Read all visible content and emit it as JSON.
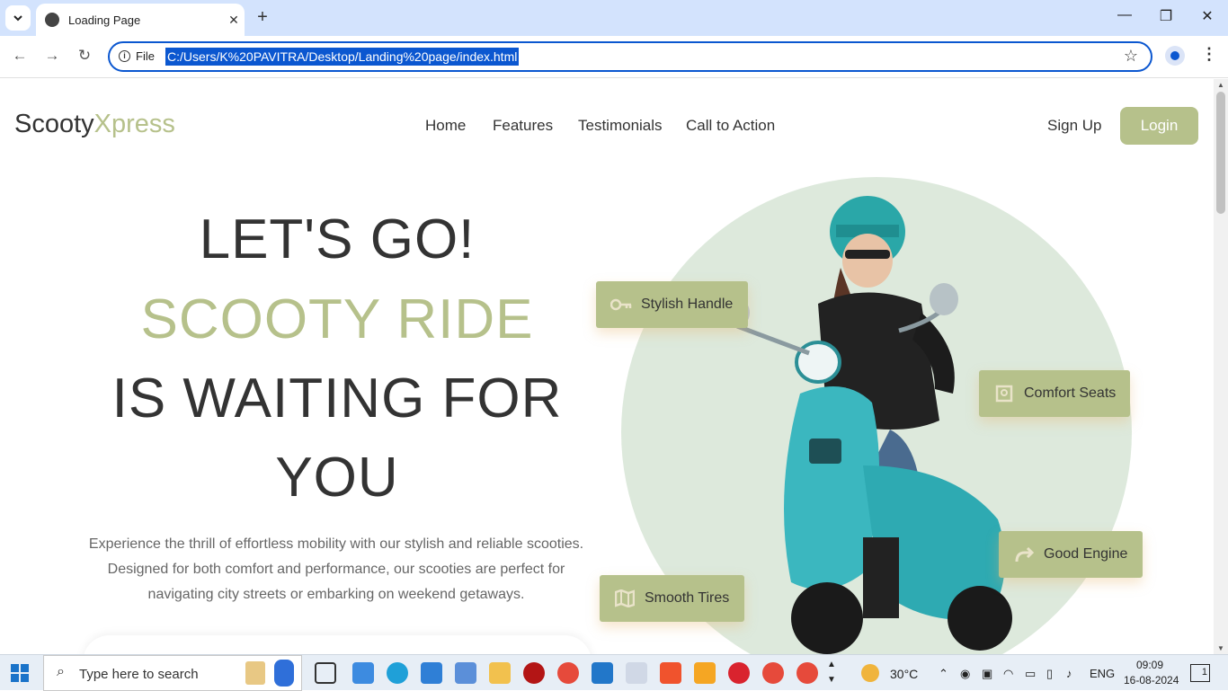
{
  "browser": {
    "tab_title": "Loading Page",
    "omnibox_label": "File",
    "url": "C:/Users/K%20PAVITRA/Desktop/Landing%20page/index.html"
  },
  "site": {
    "logo_main": "Scooty",
    "logo_accent": "Xpress",
    "nav": [
      "Home",
      "Features",
      "Testimonials",
      "Call to Action"
    ],
    "signup": "Sign Up",
    "login": "Login"
  },
  "hero": {
    "line1": "LET'S GO!",
    "line2": "SCOOTY RIDE",
    "line3": "IS WAITING FOR",
    "line4": "YOU",
    "description": "Experience the thrill of effortless mobility with our stylish and reliable scooties. Designed for both comfort and performance, our scooties are perfect for navigating city streets or embarking on weekend getaways."
  },
  "features": [
    {
      "label": "Stylish Handle",
      "icon": "key-icon"
    },
    {
      "label": "Comfort Seats",
      "icon": "seat-icon"
    },
    {
      "label": "Good Engine",
      "icon": "route-icon"
    },
    {
      "label": "Smooth Tires",
      "icon": "map-icon"
    }
  ],
  "taskbar": {
    "search_placeholder": "Type here to search",
    "weather": "30°C",
    "lang": "ENG",
    "time": "09:09",
    "date": "16-08-2024",
    "notifications": "1"
  },
  "colors": {
    "accent": "#b6c18b",
    "circle": "#dde9dc",
    "browser_blue": "#0b57d0"
  }
}
